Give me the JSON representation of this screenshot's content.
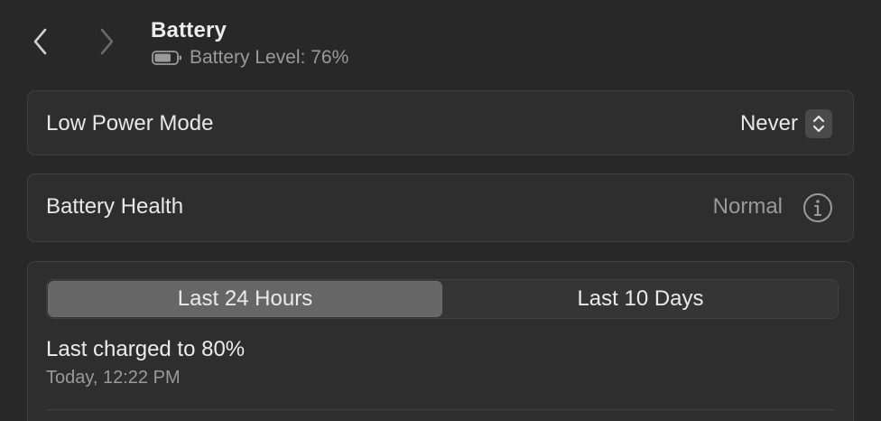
{
  "header": {
    "title": "Battery",
    "subtitle": "Battery Level: 76%",
    "battery_level_fraction": 0.76
  },
  "low_power_mode": {
    "label": "Low Power Mode",
    "value": "Never"
  },
  "battery_health": {
    "label": "Battery Health",
    "value": "Normal"
  },
  "history": {
    "tabs": [
      {
        "label": "Last 24 Hours",
        "selected": true
      },
      {
        "label": "Last 10 Days",
        "selected": false
      }
    ],
    "last_charged": "Last charged to 80%",
    "last_charged_time": "Today, 12:22 PM"
  },
  "icons": {
    "back": "chevron-left-icon",
    "forward": "chevron-right-icon",
    "battery": "battery-icon",
    "stepper": "up-down-chevron-icon",
    "info": "info-circle-icon"
  },
  "colors": {
    "background": "#282828",
    "card": "#2e2e2e",
    "selected_segment": "#666666"
  }
}
